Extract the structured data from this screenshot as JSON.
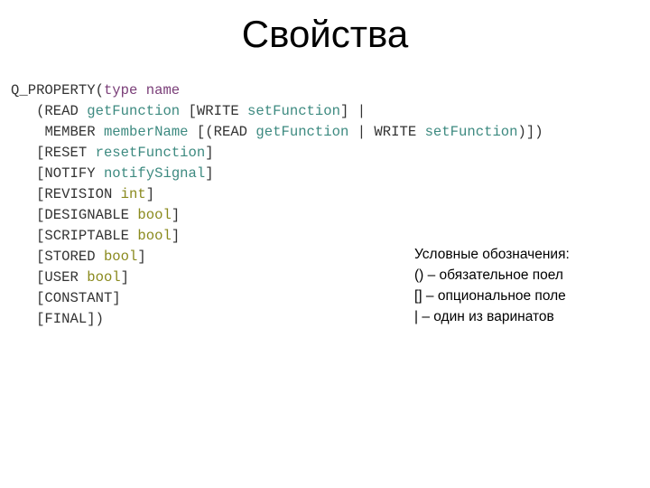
{
  "title": "Свойства",
  "code": {
    "lines": [
      {
        "indent": "",
        "tokens": [
          {
            "t": "Q_PROPERTY(",
            "c": "plain"
          },
          {
            "t": "type name",
            "c": "kw"
          }
        ]
      },
      {
        "indent": "   ",
        "tokens": [
          {
            "t": "(READ ",
            "c": "plain"
          },
          {
            "t": "getFunction",
            "c": "fn"
          },
          {
            "t": " [WRITE ",
            "c": "plain"
          },
          {
            "t": "setFunction",
            "c": "fn"
          },
          {
            "t": "] |",
            "c": "plain"
          }
        ]
      },
      {
        "indent": "    ",
        "tokens": [
          {
            "t": "MEMBER ",
            "c": "plain"
          },
          {
            "t": "memberName",
            "c": "fn"
          },
          {
            "t": " [(READ ",
            "c": "plain"
          },
          {
            "t": "getFunction",
            "c": "fn"
          },
          {
            "t": " | WRITE ",
            "c": "plain"
          },
          {
            "t": "setFunction",
            "c": "fn"
          },
          {
            "t": ")])",
            "c": "plain"
          }
        ]
      },
      {
        "indent": "   ",
        "tokens": [
          {
            "t": "[RESET ",
            "c": "plain"
          },
          {
            "t": "resetFunction",
            "c": "fn"
          },
          {
            "t": "]",
            "c": "plain"
          }
        ]
      },
      {
        "indent": "   ",
        "tokens": [
          {
            "t": "[NOTIFY ",
            "c": "plain"
          },
          {
            "t": "notifySignal",
            "c": "fn"
          },
          {
            "t": "]",
            "c": "plain"
          }
        ]
      },
      {
        "indent": "   ",
        "tokens": [
          {
            "t": "[REVISION ",
            "c": "plain"
          },
          {
            "t": "int",
            "c": "type"
          },
          {
            "t": "]",
            "c": "plain"
          }
        ]
      },
      {
        "indent": "   ",
        "tokens": [
          {
            "t": "[DESIGNABLE ",
            "c": "plain"
          },
          {
            "t": "bool",
            "c": "type"
          },
          {
            "t": "]",
            "c": "plain"
          }
        ]
      },
      {
        "indent": "   ",
        "tokens": [
          {
            "t": "[SCRIPTABLE ",
            "c": "plain"
          },
          {
            "t": "bool",
            "c": "type"
          },
          {
            "t": "]",
            "c": "plain"
          }
        ]
      },
      {
        "indent": "   ",
        "tokens": [
          {
            "t": "[STORED ",
            "c": "plain"
          },
          {
            "t": "bool",
            "c": "type"
          },
          {
            "t": "]",
            "c": "plain"
          }
        ]
      },
      {
        "indent": "   ",
        "tokens": [
          {
            "t": "[USER ",
            "c": "plain"
          },
          {
            "t": "bool",
            "c": "type"
          },
          {
            "t": "]",
            "c": "plain"
          }
        ]
      },
      {
        "indent": "   ",
        "tokens": [
          {
            "t": "[CONSTANT]",
            "c": "plain"
          }
        ]
      },
      {
        "indent": "   ",
        "tokens": [
          {
            "t": "[FINAL])",
            "c": "plain"
          }
        ]
      }
    ]
  },
  "legend": {
    "heading": "Условные обозначения:",
    "items": [
      "() – обязательное поел",
      "[] – опциональное поле",
      " | – один из варинатов"
    ]
  },
  "colors": {
    "plain": "#333333",
    "keyword": "#7a3e78",
    "function": "#3d8a80",
    "type": "#8a8a1e"
  }
}
